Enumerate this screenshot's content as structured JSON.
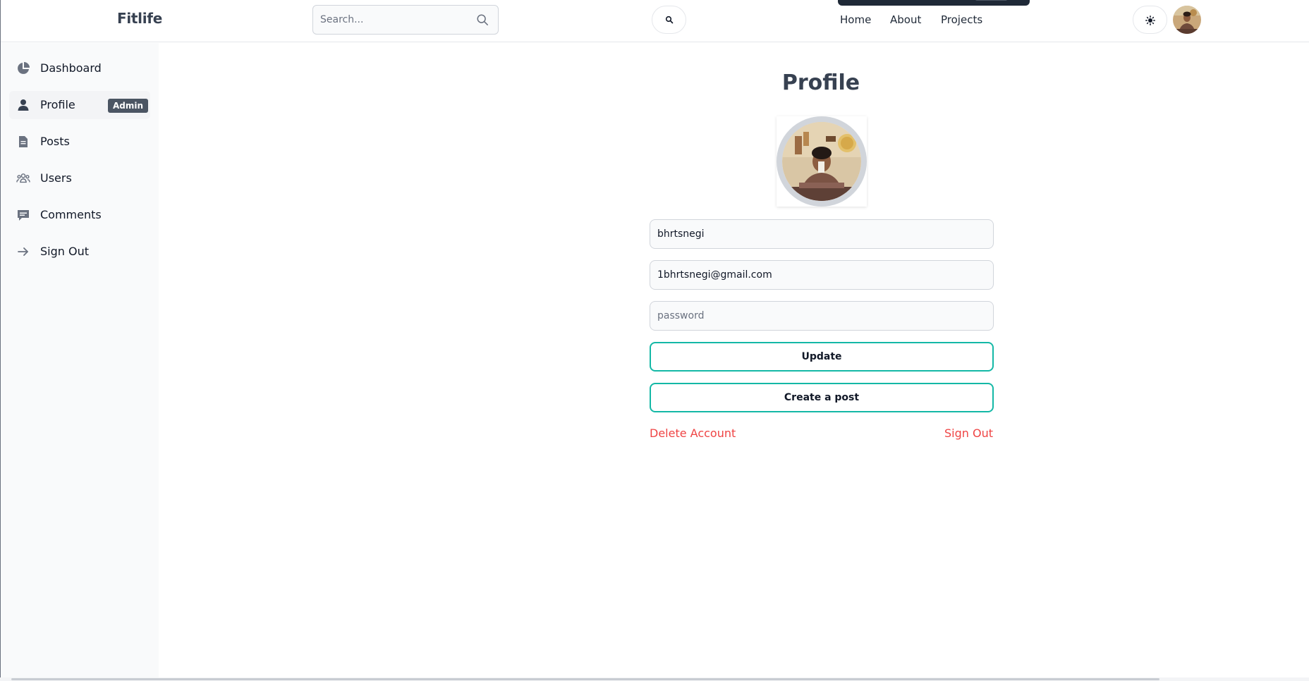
{
  "header": {
    "brand": "Fitlife",
    "search_placeholder": "Search...",
    "nav": [
      {
        "label": "Home"
      },
      {
        "label": "About"
      },
      {
        "label": "Projects"
      }
    ],
    "icons": {
      "search": "search-icon",
      "theme": "sun-icon",
      "avatar": "user-avatar"
    }
  },
  "sidebar": {
    "items": [
      {
        "label": "Dashboard",
        "icon": "pie-chart-icon"
      },
      {
        "label": "Profile",
        "icon": "user-icon",
        "badge": "Admin",
        "active": true
      },
      {
        "label": "Posts",
        "icon": "document-icon"
      },
      {
        "label": "Users",
        "icon": "users-icon"
      },
      {
        "label": "Comments",
        "icon": "comment-icon"
      },
      {
        "label": "Sign Out",
        "icon": "arrow-right-icon"
      }
    ]
  },
  "main": {
    "title": "Profile",
    "form": {
      "username_value": "bhrtsnegi",
      "email_value": "1bhrtsnegi@gmail.com",
      "password_placeholder": "password",
      "update_label": "Update",
      "create_post_label": "Create a post"
    },
    "actions": {
      "delete_label": "Delete Account",
      "signout_label": "Sign Out"
    }
  },
  "colors": {
    "accent": "#14b8a6",
    "danger": "#ef4444",
    "badge": "#4b5563",
    "sidebar_bg": "#f9fafb"
  }
}
